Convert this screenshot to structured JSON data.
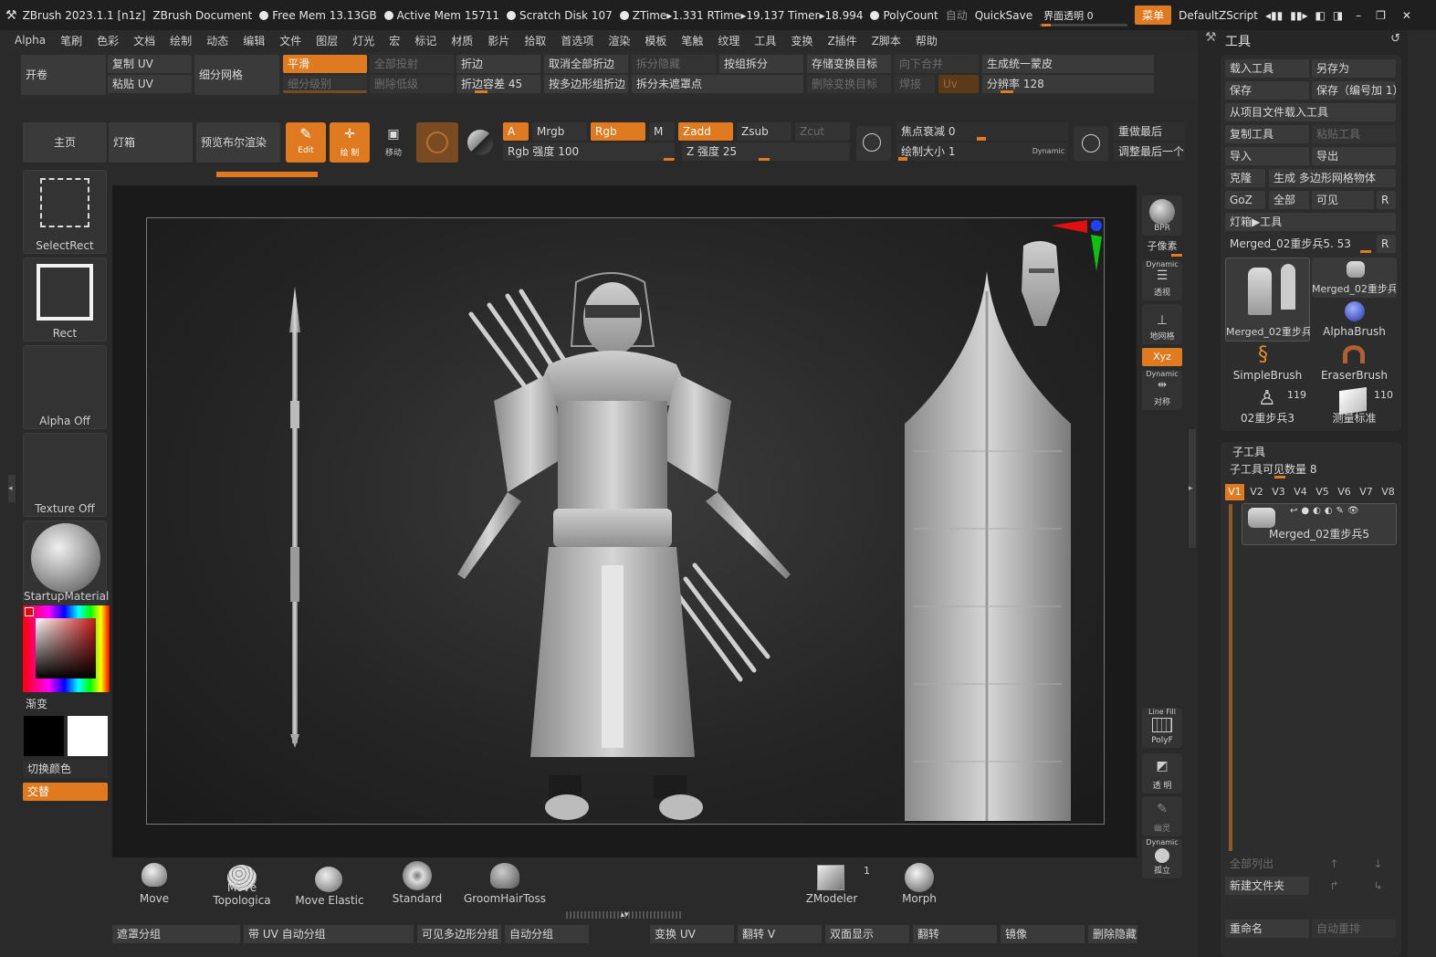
{
  "title": {
    "app": "ZBrush 2023.1.1 [n1z]",
    "doc": "ZBrush Document",
    "free_mem": "Free Mem 13.13GB",
    "active_mem": "Active Mem 15711",
    "scratch": "Scratch Disk 107",
    "ztime": "ZTime▸1.331 RTime▸19.137 Timer▸18.994",
    "polycount": "PolyCount",
    "auto": "自动",
    "quicksave": "QuickSave",
    "transparency": "界面透明 0",
    "menu": "菜单",
    "script": "DefaultZScript"
  },
  "menus": [
    "Alpha",
    "笔刷",
    "色彩",
    "文档",
    "绘制",
    "动态",
    "编辑",
    "文件",
    "图层",
    "灯光",
    "宏",
    "标记",
    "材质",
    "影片",
    "拾取",
    "首选项",
    "渲染",
    "模板",
    "笔触",
    "纹理",
    "工具",
    "变换",
    "Z插件",
    "Z脚本",
    "帮助"
  ],
  "top_shelf": {
    "kaijuan": "开卷",
    "copy_uv": "复制 UV",
    "paste_uv": "粘贴 UV",
    "subdiv_mesh": "细分网格",
    "smooth": "平滑",
    "subdiv_level": "细分级别",
    "project_all": "全部投射",
    "del_lower": "删除低级",
    "crease": "折边",
    "crease_tol_label": "折边容差",
    "crease_tol_value": "45",
    "uncrease_all": "取消全部折边",
    "crease_by_poly": "按多边形组折边",
    "split_hidden": "拆分隐藏",
    "split_unmasked": "拆分未遮罩点",
    "split_by_group": "按组拆分",
    "store_morph": "存储变换目标",
    "del_morph": "删除变换目标",
    "merge_down": "向下合并",
    "weld": "焊接",
    "uv": "Uv",
    "unified_skin": "生成统一蒙皮",
    "resolution_label": "分辨率",
    "resolution_value": "128"
  },
  "second_shelf": {
    "home": "主页",
    "lightbox": "灯箱",
    "preview_bool": "预览布尔渲染",
    "edit": "Edit",
    "draw": "绘 制",
    "move": "移动",
    "a": "A",
    "mrgb": "Mrgb",
    "rgb": "Rgb",
    "m": "M",
    "zadd": "Zadd",
    "zsub": "Zsub",
    "zcut": "Zcut",
    "rgb_intensity": "Rgb 强度 100",
    "z_intensity": "Z 强度 25",
    "focal_shift": "焦点衰减 0",
    "draw_size": "绘制大小 1",
    "dynamic": "Dynamic",
    "redo_last": "重做最后",
    "adjust_last": "调整最后一个"
  },
  "left_tray": {
    "select_rect": "SelectRect",
    "rect": "Rect",
    "alpha_off": "Alpha Off",
    "texture_off": "Texture Off",
    "material": "StartupMaterial",
    "gradient": "渐变",
    "switch_color": "切换颜色",
    "alternate": "交替"
  },
  "right_shelf": {
    "bpr": "BPR",
    "subpixel": "子像素",
    "dynamic": "Dynamic",
    "persp": "透视",
    "floor": "地网格",
    "xyz": "Xyz",
    "sym": "对称",
    "linefill": "Line Fill",
    "polyf": "PolyF",
    "transp": "透 明",
    "ghost": "幽灵",
    "solo": "孤立"
  },
  "tool_panel": {
    "title": "工具",
    "load_tool": "载入工具",
    "save_as": "另存为",
    "save": "保存",
    "save_numbered": "保存（编号加 1）",
    "load_from_project": "从项目文件载入工具",
    "copy_tool": "复制工具",
    "paste_tool": "粘贴工具",
    "import": "导入",
    "export": "导出",
    "clone": "克隆",
    "make_polymesh": "生成 多边形网格物体",
    "goz": "GoZ",
    "all": "全部",
    "visible": "可见",
    "r": "R",
    "lightbox_tool": "灯箱▶工具",
    "current_tool": "Merged_02重步兵5. 53",
    "tools": [
      {
        "name": "Merged_02重步兵"
      },
      {
        "name": "Merged_02重步兵"
      },
      {
        "name": "AlphaBrush"
      },
      {
        "name": "SimpleBrush"
      },
      {
        "name": "EraserBrush"
      },
      {
        "name": "02重步兵3",
        "count": "119"
      },
      {
        "name": "测量标准",
        "count": "110"
      }
    ]
  },
  "subtool": {
    "title": "子工具",
    "visible_count": "子工具可见数量 8",
    "tabs": [
      "V1",
      "V2",
      "V3",
      "V4",
      "V5",
      "V6",
      "V7",
      "V8"
    ],
    "item": "Merged_02重步兵5",
    "list_all": "全部列出",
    "new_folder": "新建文件夹",
    "rename": "重命名",
    "auto_reorder": "自动重排"
  },
  "brushes": [
    {
      "name": "Move"
    },
    {
      "name": "Move Topologica"
    },
    {
      "name": "Move Elastic"
    },
    {
      "name": "Standard"
    },
    {
      "name": "GroomHairToss"
    },
    {
      "name": "ZModeler",
      "count": "1"
    },
    {
      "name": "Morph"
    }
  ],
  "bottom_shelf": [
    "遮罩分组",
    "带 UV 自动分组",
    "可见多边形分组",
    "自动分组",
    "变换 UV",
    "翻转 V",
    "双面显示",
    "翻转",
    "镜像",
    "删除隐藏"
  ],
  "colors": {
    "accent": "#e07a20",
    "panel": "#2f2f2f",
    "button": "#3a3a3a"
  }
}
